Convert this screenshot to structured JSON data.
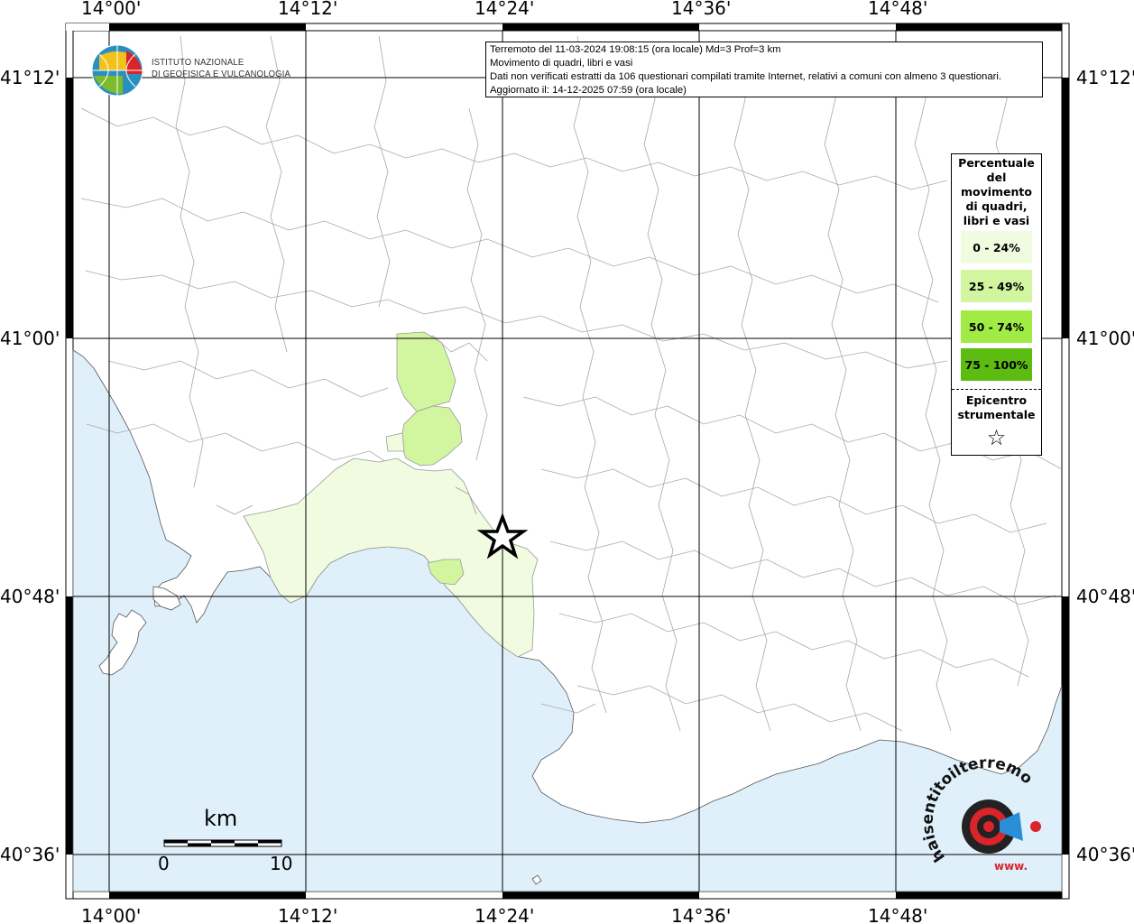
{
  "map": {
    "lon_ticks": [
      "14°00'",
      "14°12'",
      "14°24'",
      "14°36'",
      "14°48'"
    ],
    "lat_ticks": [
      "41°12'",
      "41°00'",
      "40°48'",
      "40°36'"
    ]
  },
  "info": {
    "line1": "Terremoto del 11-03-2024 19:08:15 (ora locale) Md=3 Prof=3 km",
    "line2": "Movimento di quadri, libri e vasi",
    "line3": "Dati non verificati estratti da 106 questionari compilati tramite Internet, relativi a comuni con almeno 3 questionari.",
    "line4": "Aggiornato il: 14-12-2025 07:59 (ora locale)"
  },
  "legend": {
    "title": "Percentuale del movimento di quadri, libri e vasi",
    "classes": [
      {
        "label": "0 - 24%",
        "color": "#f0fbe0"
      },
      {
        "label": "25 - 49%",
        "color": "#d2f5a0"
      },
      {
        "label": "50 - 74%",
        "color": "#a0ec44"
      },
      {
        "label": "75 - 100%",
        "color": "#5cbc12"
      }
    ],
    "epicenter_label": "Epicentro strumentale",
    "epicenter_symbol": "☆"
  },
  "logo": {
    "line1": "ISTITUTO NAZIONALE",
    "line2": "DI GEOFISICA E VULCANOLOGIA"
  },
  "scalebar": {
    "unit": "km",
    "start": "0",
    "end": "10"
  },
  "badge": {
    "text": "haisentitoilterremoto.it",
    "www": "www."
  },
  "colors": {
    "sea": "#e0f0fb",
    "land": "#ffffff",
    "boundary": "#9a9a9a",
    "grid": "#000000"
  }
}
